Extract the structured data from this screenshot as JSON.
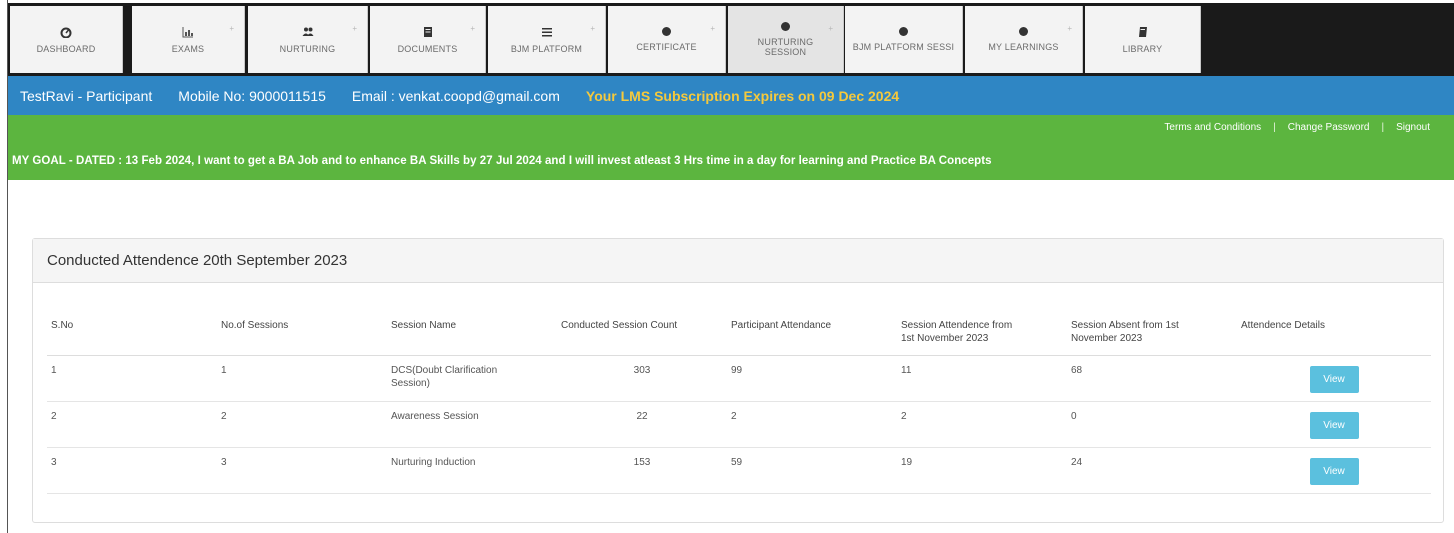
{
  "nav": {
    "tabs": [
      {
        "label": "DASHBOARD",
        "icon": "dashboard-icon"
      },
      {
        "label": "EXAMS",
        "icon": "chart-icon"
      },
      {
        "label": "NURTURING",
        "icon": "users-icon"
      },
      {
        "label": "DOCUMENTS",
        "icon": "document-icon"
      },
      {
        "label": "BJM PLATFORM",
        "icon": "list-icon"
      },
      {
        "label": "CERTIFICATE",
        "icon": "dot-icon"
      },
      {
        "label": "NURTURING SESSION",
        "icon": "dot-icon"
      },
      {
        "label": "BJM PLATFORM SESSI",
        "icon": "dot-icon"
      },
      {
        "label": "MY LEARNINGS",
        "icon": "dot-icon"
      },
      {
        "label": "LIBRARY",
        "icon": "book-icon"
      }
    ]
  },
  "info": {
    "user": "TestRavi - Participant",
    "mobile": "Mobile No: 9000011515",
    "email": "Email : venkat.coopd@gmail.com",
    "expiry": "Your LMS Subscription Expires on 09 Dec 2024"
  },
  "links": {
    "terms": "Terms and Conditions",
    "divider": "|",
    "change_password": "Change Password",
    "signout": "Signout"
  },
  "goal": "MY GOAL - DATED : 13 Feb 2024, I want to get a BA Job and to enhance BA Skills by 27 Jul 2024 and I will invest atleast 3 Hrs time in a day for learning and Practice BA Concepts",
  "panel": {
    "title": "Conducted Attendence 20th September 2023",
    "headers": [
      "S.No",
      "No.of Sessions",
      "Session Name",
      "Conducted Session Count",
      "Participant Attendance",
      "Session Attendence from 1st November 2023",
      "Session Absent from 1st November 2023",
      "Attendence Details"
    ],
    "rows": [
      {
        "sno": "1",
        "sessions": "1",
        "name": "DCS(Doubt Clarification Session)",
        "count": "303",
        "attendance": "99",
        "from_nov": "11",
        "absent": "68",
        "action": "View"
      },
      {
        "sno": "2",
        "sessions": "2",
        "name": "Awareness Session",
        "count": "22",
        "attendance": "2",
        "from_nov": "2",
        "absent": "0",
        "action": "View"
      },
      {
        "sno": "3",
        "sessions": "3",
        "name": "Nurturing Induction",
        "count": "153",
        "attendance": "59",
        "from_nov": "19",
        "absent": "24",
        "action": "View"
      }
    ]
  },
  "colors": {
    "nav_bg": "#1a1a1a",
    "info_bar": "#2f86c4",
    "expiry_text": "#f5c93c",
    "goal_bar": "#5cb53f",
    "view_button": "#5bc0de"
  }
}
